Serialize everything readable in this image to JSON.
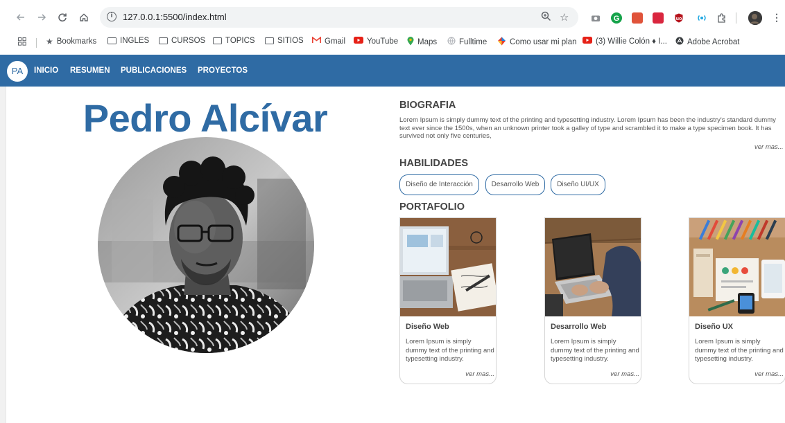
{
  "browser": {
    "url": "127.0.0.1:5500/index.html",
    "bookmarks": [
      {
        "label": "Bookmarks",
        "icon": "star-icon"
      },
      {
        "label": "INGLES",
        "icon": "folder-icon"
      },
      {
        "label": "CURSOS",
        "icon": "folder-icon"
      },
      {
        "label": "TOPICS",
        "icon": "folder-icon"
      },
      {
        "label": "SITIOS",
        "icon": "folder-icon"
      },
      {
        "label": "Gmail",
        "icon": "gmail-icon"
      },
      {
        "label": "YouTube",
        "icon": "youtube-icon"
      },
      {
        "label": "Maps",
        "icon": "maps-icon"
      },
      {
        "label": "Fulltime",
        "icon": "globe-icon"
      },
      {
        "label": "Como usar mi plan",
        "icon": "plan-icon"
      },
      {
        "label": "(3) Willie Colón ♦ I...",
        "icon": "youtube-icon"
      },
      {
        "label": "Adobe Acrobat",
        "icon": "acrobat-icon"
      }
    ]
  },
  "site": {
    "logo": "PA",
    "nav": [
      "INICIO",
      "RESUMEN",
      "PUBLICACIONES",
      "PROYECTOS"
    ],
    "name": "Pedro Alcívar",
    "colors": {
      "primary": "#2f6ba4"
    },
    "bio": {
      "title": "BIOGRAFIA",
      "text": "Lorem Ipsum is simply dummy text of the printing and typesetting industry. Lorem Ipsum has been the industry's standard dummy text ever since the 1500s, when an unknown printer took a galley of type and scrambled it to make a type specimen book. It has survived not only five centuries,",
      "more": "ver mas..."
    },
    "skills": {
      "title": "HABILIDADES",
      "items": [
        "Diseño de Interacción",
        "Desarrollo Web",
        "Diseño UI/UX"
      ]
    },
    "portfolio": {
      "title": "PORTAFOLIO",
      "cards": [
        {
          "title": "Diseño Web",
          "text": "Lorem Ipsum is simply dummy text of the printing and typesetting industry.",
          "more": "ver mas..."
        },
        {
          "title": "Desarrollo Web",
          "text": "Lorem Ipsum is simply dummy text of the printing and typesetting industry.",
          "more": "ver mas..."
        },
        {
          "title": "Diseño UX",
          "text": "Lorem Ipsum is simply dummy text of the printing and typesetting industry.",
          "more": "ver mas..."
        }
      ]
    }
  }
}
